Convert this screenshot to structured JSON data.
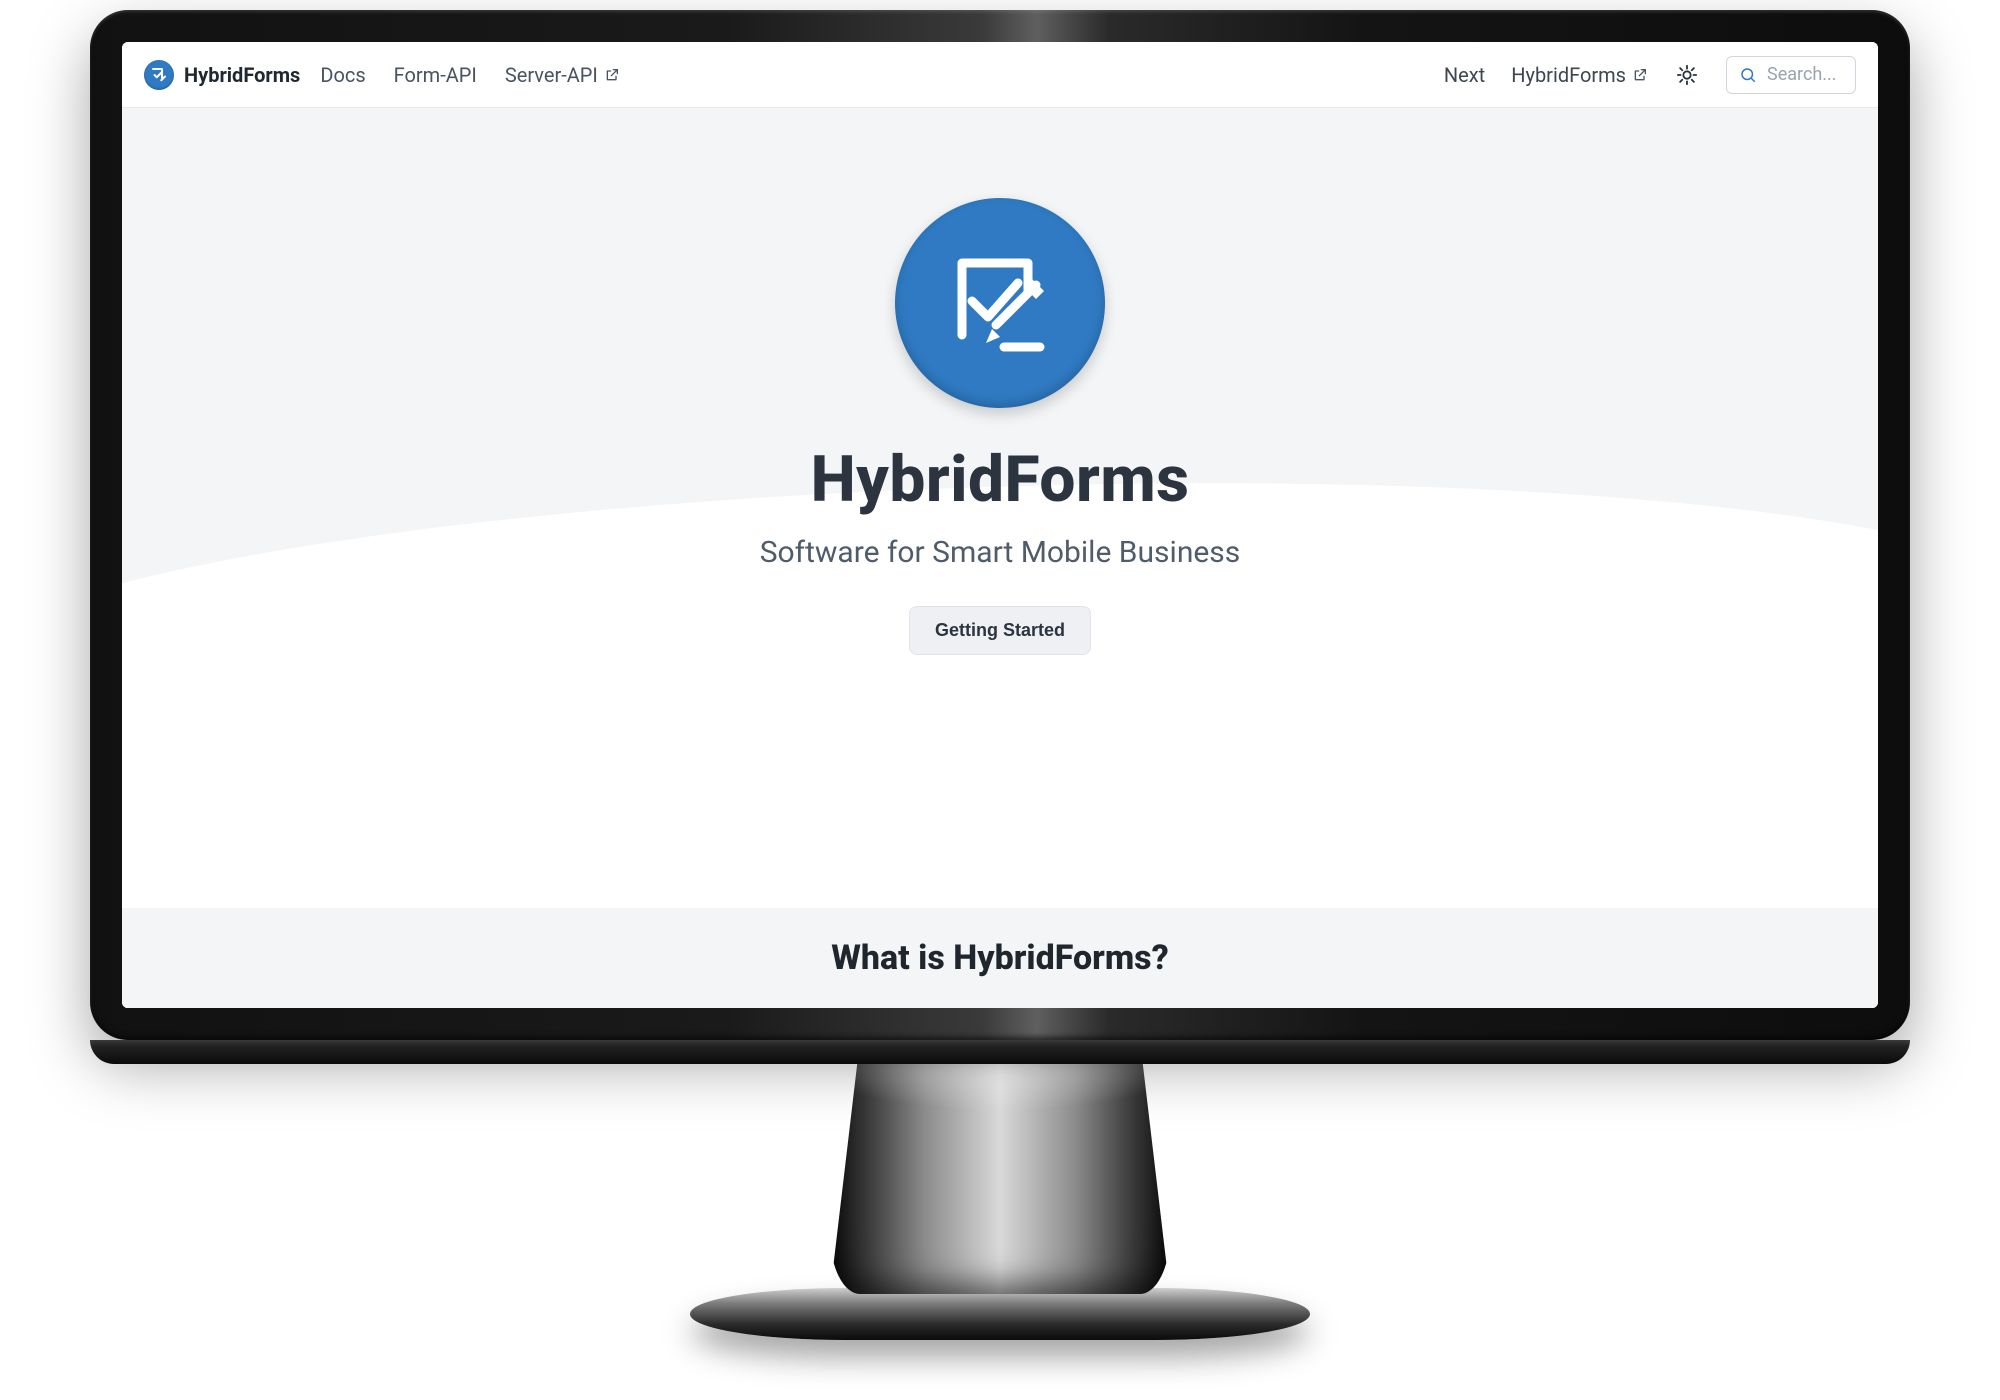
{
  "brand": {
    "name": "HybridForms"
  },
  "nav": {
    "docs": "Docs",
    "form_api": "Form-API",
    "server_api": "Server-API"
  },
  "right": {
    "next": "Next",
    "external": "HybridForms"
  },
  "search": {
    "placeholder": "Search..."
  },
  "hero": {
    "title": "HybridForms",
    "subtitle": "Software for Smart Mobile Business",
    "cta": "Getting Started"
  },
  "section": {
    "heading": "What is HybridForms?"
  }
}
